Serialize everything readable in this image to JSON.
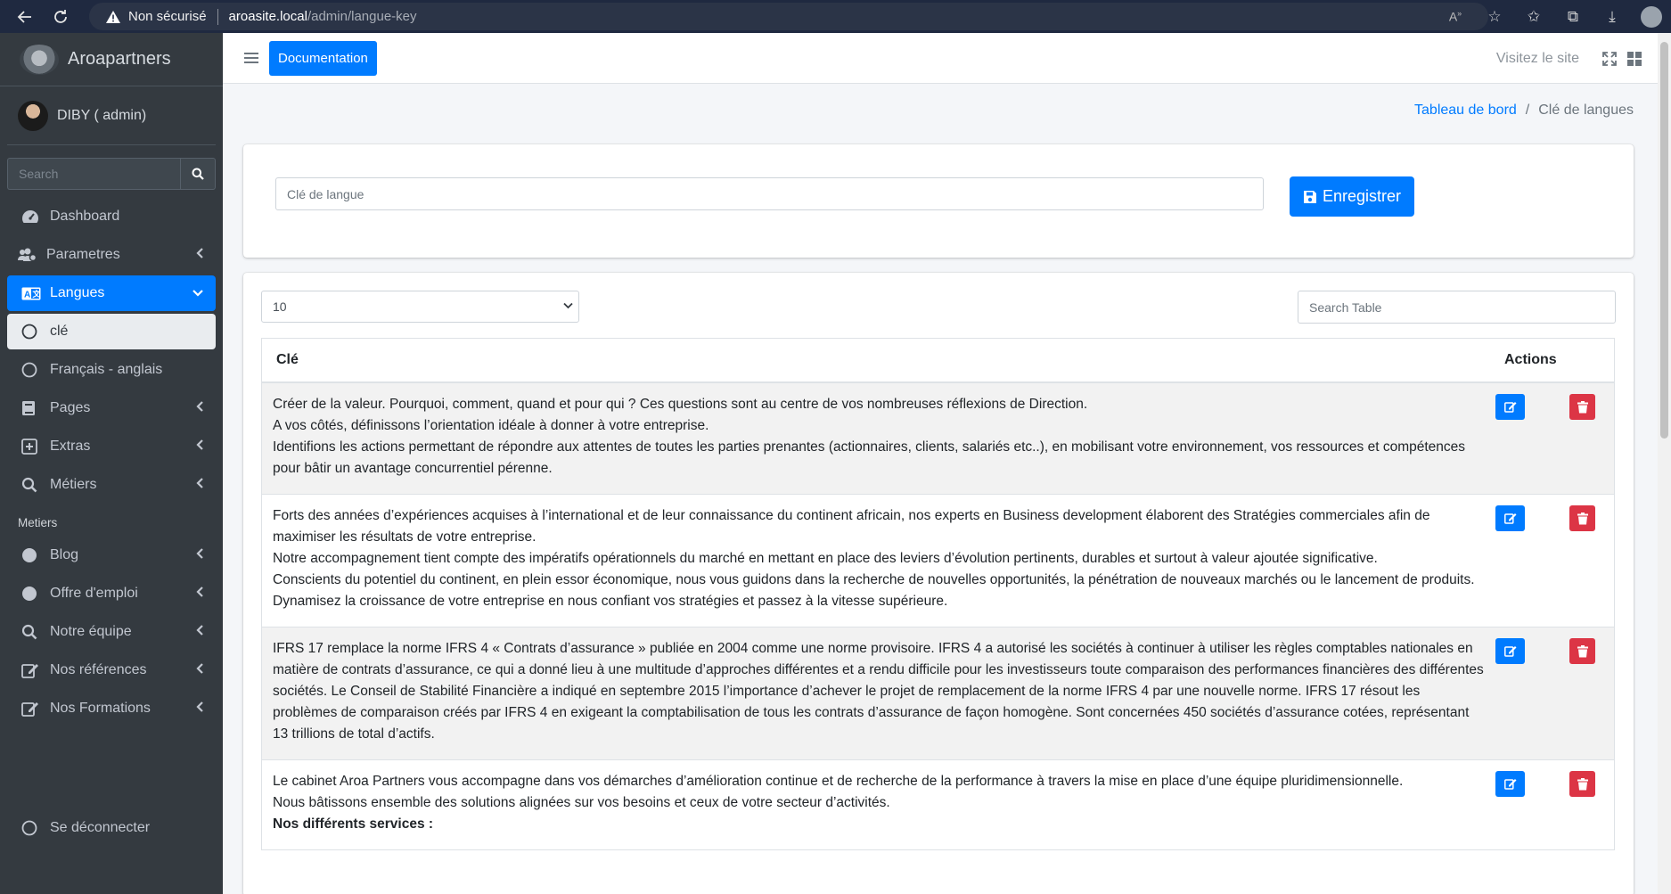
{
  "browser": {
    "security_label": "Non sécurisé",
    "url_host": "aroasite.local",
    "url_path": "/admin/langue-key"
  },
  "sidebar": {
    "brand": "Aroapartners",
    "user": "DIBY ( admin)",
    "search_placeholder": "Search",
    "items": [
      {
        "label": "Dashboard",
        "icon": "tachometer-icon"
      },
      {
        "label": "Parametres",
        "icon": "users-cog-icon"
      },
      {
        "label": "Langues",
        "icon": "language-icon"
      },
      {
        "label": "clé",
        "icon": "circle-icon"
      },
      {
        "label": "Français - anglais",
        "icon": "circle-icon"
      },
      {
        "label": "Pages",
        "icon": "book-icon"
      },
      {
        "label": "Extras",
        "icon": "plus-square-icon"
      },
      {
        "label": "Métiers",
        "icon": "search-icon"
      }
    ],
    "section_header": "Metiers",
    "items2": [
      {
        "label": "Blog",
        "icon": "circle-filled-icon"
      },
      {
        "label": "Offre d'emploi",
        "icon": "circle-filled-icon"
      },
      {
        "label": "Notre équipe",
        "icon": "search-icon"
      },
      {
        "label": "Nos références",
        "icon": "edit-icon"
      },
      {
        "label": "Nos Formations",
        "icon": "edit-icon"
      }
    ],
    "logout": "Se déconnecter"
  },
  "topnav": {
    "doc_button": "Documentation",
    "visit_site": "Visitez le site"
  },
  "breadcrumb": {
    "home": "Tableau de bord",
    "separator": "/",
    "current": "Clé de langues"
  },
  "form": {
    "key_placeholder": "Clé de langue",
    "save_label": "Enregistrer"
  },
  "table": {
    "page_length": "10",
    "search_placeholder": "Search Table",
    "col_key": "Clé",
    "col_actions": "Actions",
    "rows": [
      {
        "lines": [
          "Créer de la valeur. Pourquoi, comment, quand et pour qui ? Ces questions sont au centre de vos nombreuses réflexions de Direction.",
          "A vos côtés, définissons l’orientation idéale à donner à votre entreprise.",
          "Identifions les actions permettant de répondre aux attentes de toutes les parties prenantes (actionnaires, clients, salariés etc..), en mobilisant votre environnement, vos ressources et compétences pour bâtir un avantage concurrentiel pérenne."
        ]
      },
      {
        "lines": [
          "Forts des années d’expériences acquises à l’international et de leur connaissance du continent africain, nos experts en Business development élaborent des Stratégies commerciales afin de maximiser les résultats de votre entreprise.",
          "Notre accompagnement tient compte des impératifs opérationnels du marché en mettant en place des leviers d’évolution pertinents, durables et surtout à valeur ajoutée significative.",
          "Conscients du potentiel du continent, en plein essor économique, nous vous guidons dans la recherche de nouvelles opportunités, la pénétration de nouveaux marchés ou le lancement de produits.",
          "Dynamisez la croissance de votre entreprise en nous confiant vos stratégies et passez à la vitesse supérieure."
        ]
      },
      {
        "lines": [
          "IFRS 17 remplace la norme IFRS 4 « Contrats d’assurance » publiée en 2004 comme une norme provisoire. IFRS 4 a autorisé les sociétés à continuer à utiliser les règles comptables nationales en matière de contrats d’assurance, ce qui a donné lieu à une multitude d’approches différentes et a rendu difficile pour les investisseurs toute comparaison des performances financières des différentes sociétés. Le Conseil de Stabilité Financière a indiqué en septembre 2015 l’importance d’achever le projet de remplacement de la norme IFRS 4 par une nouvelle norme. IFRS 17 résout les problèmes de comparaison créés par IFRS 4 en exigeant la comptabilisation de tous les contrats d’assurance de façon homogène. Sont concernées 450 sociétés d’assurance cotées, représentant 13 trillions de total d’actifs."
        ]
      },
      {
        "lines": [
          "Le cabinet Aroa Partners vous accompagne dans vos démarches d’amélioration continue et de recherche de la performance à travers la mise en place d’une équipe pluridimensionnelle.",
          "Nous bâtissons ensemble des solutions alignées sur vos besoins et ceux de votre secteur d’activités."
        ],
        "bold_line": "Nos différents services :"
      }
    ]
  },
  "colors": {
    "primary": "#007bff",
    "danger": "#dc3545",
    "sidebar_bg": "#343a40",
    "browser_bg": "#1f2940"
  }
}
